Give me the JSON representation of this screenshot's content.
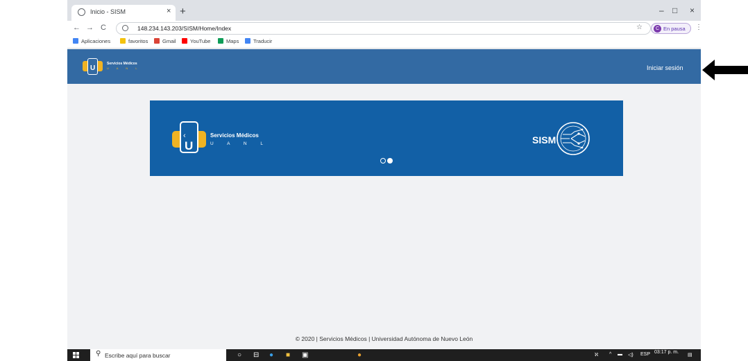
{
  "browser": {
    "tab_title": "Inicio - SISM",
    "tab_close": "×",
    "new_tab": "+",
    "window_controls": [
      "–",
      "□",
      "×"
    ],
    "nav": {
      "back": "←",
      "forward": "→",
      "reload": "C"
    },
    "url": "148.234.143.203/SISM/Home/Index",
    "star": "☆",
    "profile_initial": "C",
    "profile_label": "En pausa",
    "menu": "⋮",
    "bookmarks": [
      {
        "label": "Aplicaciones",
        "color": "#4285f4"
      },
      {
        "label": "favoritos",
        "color": "#f4c20d"
      },
      {
        "label": "Gmail",
        "color": "#db4437"
      },
      {
        "label": "YouTube",
        "color": "#ff0000"
      },
      {
        "label": "Maps",
        "color": "#0f9d58"
      },
      {
        "label": "Traducir",
        "color": "#4285f4"
      }
    ]
  },
  "site": {
    "brand_name": "Servicios Médicos",
    "brand_sub": "U A N L",
    "login_label": "Iniciar sesión",
    "banner": {
      "title": "Servicios Médicos",
      "subtitle": "U A N L",
      "sism_label": "SISM",
      "slides": 2,
      "active_slide": 2
    },
    "footer": "© 2020 | Servicios Médicos | Universidad Autónoma de Nuevo León"
  },
  "taskbar": {
    "search_placeholder": "Escribe aquí para buscar",
    "language": "ESP",
    "time": "03:17 p. m."
  },
  "colors": {
    "header_blue": "#336aa3",
    "banner_blue": "#1260a6",
    "brand_yellow": "#f0b323",
    "page_bg": "#f1f2f4"
  }
}
